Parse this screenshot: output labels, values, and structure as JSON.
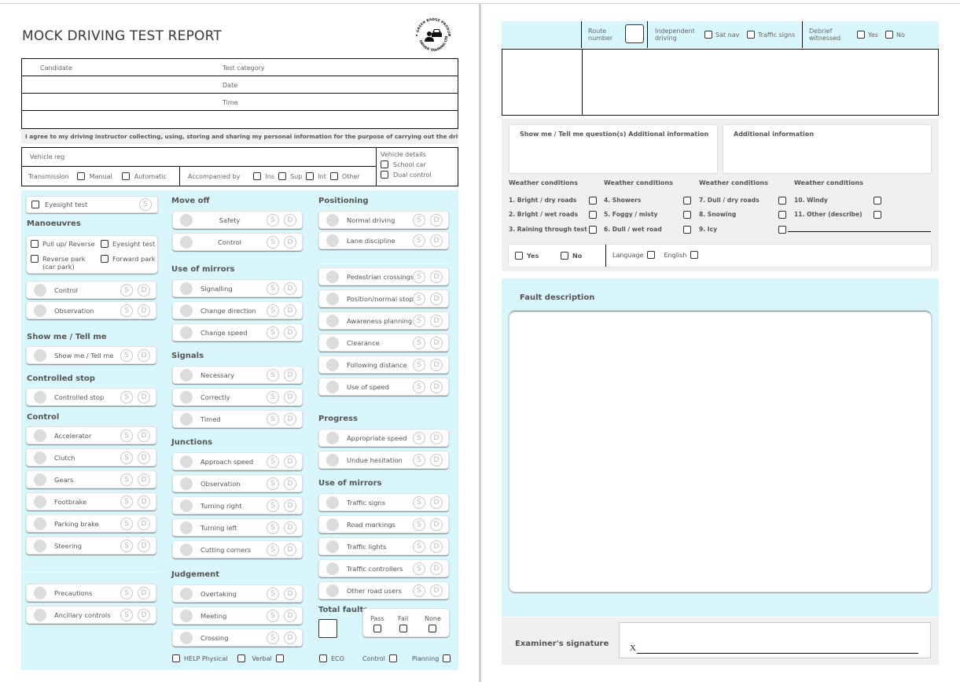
{
  "title": "MOCK DRIVING TEST REPORT",
  "logo": {
    "icon": "driver-car-icon",
    "top_text": "GREEN BADGE PRODUCTS",
    "bottom_text": "DRIVER TRAINING LTD"
  },
  "info": {
    "candidate_label": "Candidate",
    "test_category_label": "Test category",
    "date_label": "Date",
    "time_label": "Time"
  },
  "consent": "I agree to my driving instructor collecting, using, storing and sharing my personal information for the purpose of carrying out the driving test.",
  "vehicle": {
    "reg_label": "Vehicle reg",
    "transmission_label": "Transmission",
    "manual": "Manual",
    "automatic": "Automatic",
    "accompanied_label": "Accompanied by",
    "accompanied_options": [
      "Ins",
      "Sup",
      "Int",
      "Other"
    ],
    "details_label": "Vehicle details",
    "school_car": "School car",
    "dual_control": "Dual control"
  },
  "sd": {
    "s": "S",
    "d": "D"
  },
  "col1": {
    "eyesight": "Eyesight test",
    "manoeuvres_heading": "Manoeuvres",
    "manoeuvres": [
      "Pull up/ Reverse",
      "Eyesight test",
      "Reverse park\n(car park)",
      "Forward park"
    ],
    "manoeuvres_line1": "Reverse park",
    "manoeuvres_line2": "(car park)",
    "man_items": [
      "Control",
      "Observation"
    ],
    "showme_heading": "Show me / Tell me",
    "showme_items": [
      "Show me / Tell me"
    ],
    "controlled_stop_heading": "Controlled stop",
    "controlled_stop_items": [
      "Controlled stop"
    ],
    "control_heading": "Control",
    "control_items": [
      "Accelerator",
      "Clutch",
      "Gears",
      "Footbrake",
      "Parking brake",
      "Steering"
    ],
    "extra_items": [
      "Precautions",
      "Ancillary controls"
    ]
  },
  "col2": {
    "move_off_heading": "Move off",
    "move_off_items": [
      "Safety",
      "Control"
    ],
    "mirrors_heading": "Use of mirrors",
    "mirrors_items": [
      "Signalling",
      "Change direction",
      "Change speed"
    ],
    "signals_heading": "Signals",
    "signals_items": [
      "Necessary",
      "Correctly",
      "Timed"
    ],
    "junctions_heading": "Junctions",
    "junctions_items": [
      "Approach speed",
      "Observation",
      "Turning right",
      "Turning left",
      "Cutting corners"
    ],
    "judgement_heading": "Judgement",
    "judgement_items": [
      "Overtaking",
      "Meeting",
      "Crossing"
    ],
    "help_physical": "HELP Physical",
    "verbal": "Verbal"
  },
  "col3": {
    "positioning_heading": "Positioning",
    "positioning_items": [
      "Normal driving",
      "Lane discipline"
    ],
    "other_items": [
      "Pedestrian crossings",
      "Position/normal stop",
      "Awareness planning",
      "Clearance",
      "Following distance",
      "Use of speed"
    ],
    "progress_heading": "Progress",
    "progress_items": [
      "Appropriate speed",
      "Undue hesitation"
    ],
    "mirrors_heading": "Use of mirrors",
    "mirrors_items": [
      "Traffic signs",
      "Road markings",
      "Traffic lights",
      "Traffic controllers",
      "Other road users"
    ],
    "total_faults": "Total faults",
    "pass": "Pass",
    "fail": "Fail",
    "none": "None",
    "eco": "ECO",
    "control": "Control",
    "planning": "Planning"
  },
  "right": {
    "route_number": "Route number",
    "route_line1": "Route",
    "route_line2": "number",
    "independent_line1": "Independent",
    "independent_line2": "driving",
    "sat_nav": "Sat nav",
    "traffic_signs": "Traffic signs",
    "debrief_line1": "Debrief",
    "debrief_line2": "witnessed",
    "yes": "Yes",
    "no": "No",
    "showme_info": "Show me / Tell me question(s) Additional information",
    "additional_info": "Additional information",
    "weather_heading": "Weather conditions",
    "weather": [
      [
        "1. Bright / dry roads",
        "2. Bright / wet roads",
        "3. Raining through test"
      ],
      [
        "4. Showers",
        "5. Foggy / misty",
        "6. Dull / wet road"
      ],
      [
        "7. Dull / dry roads",
        "8. Snowing",
        "9. Icy"
      ],
      [
        "10. Windy",
        "11. Other (describe)"
      ]
    ],
    "yn_yes": "Yes",
    "yn_no": "No",
    "language": "Language",
    "english": "English",
    "fault_description": "Fault description",
    "examiner_signature": "Examiner's signature",
    "signature_mark": "X"
  }
}
